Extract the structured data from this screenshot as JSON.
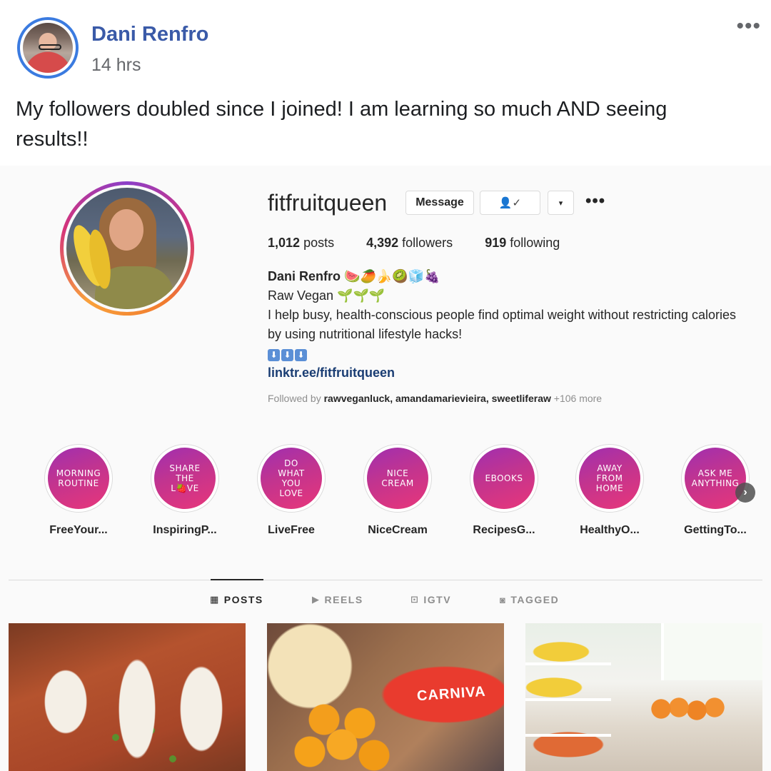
{
  "post": {
    "author": "Dani Renfro",
    "time": "14 hrs",
    "menu": "•••",
    "text": "My followers doubled since I joined! I am learning so much AND seeing results!!"
  },
  "profile": {
    "username": "fitfruitqueen",
    "message_button": "Message",
    "follow_icon": "👤✓",
    "dropdown_icon": "▾",
    "more": "•••",
    "stats": {
      "posts_count": "1,012",
      "posts_label": "posts",
      "followers_count": "4,392",
      "followers_label": "followers",
      "following_count": "919",
      "following_label": "following"
    },
    "bio": {
      "name": "Dani Renfro",
      "name_emojis": "🍉🥭🍌🥝🧊🍇",
      "line1": "Raw Vegan 🌱🌱🌱",
      "line2": "I help busy, health-conscious people find optimal weight without restricting calories by using nutritional lifestyle hacks!",
      "arrows": [
        "⬇",
        "⬇",
        "⬇"
      ],
      "link": "linktr.ee/fitfruitqueen"
    },
    "followed_by": {
      "prefix": "Followed by",
      "names": "rawveganluck, amandamarievieira, sweetliferaw",
      "more": "+106 more"
    }
  },
  "highlights": [
    {
      "cover_text": "MORNING\nROUTINE",
      "label": "FreeYour..."
    },
    {
      "cover_text": "SHARE\nTHE\nL🍓VE",
      "label": "InspiringP..."
    },
    {
      "cover_text": "DO\nWHAT\nYOU\nLOVE",
      "label": "LiveFree"
    },
    {
      "cover_text": "NICE\nCREAM",
      "label": "NiceCream"
    },
    {
      "cover_text": "EBOOKS",
      "label": "RecipesG..."
    },
    {
      "cover_text": "AWAY\nFROM\nHOME",
      "label": "HealthyO..."
    },
    {
      "cover_text": "ASK ME\nANYTHING",
      "label": "GettingTo..."
    }
  ],
  "highlights_next": "›",
  "tabs": [
    {
      "icon": "grid-icon",
      "glyph": "▦",
      "label": "POSTS",
      "active": true
    },
    {
      "icon": "reels-icon",
      "glyph": "▶",
      "label": "REELS",
      "active": false
    },
    {
      "icon": "igtv-icon",
      "glyph": "⊡",
      "label": "IGTV",
      "active": false
    },
    {
      "icon": "tagged-icon",
      "glyph": "◙",
      "label": "TAGGED",
      "active": false
    }
  ],
  "grid_post_2_label": "CARNIVA"
}
